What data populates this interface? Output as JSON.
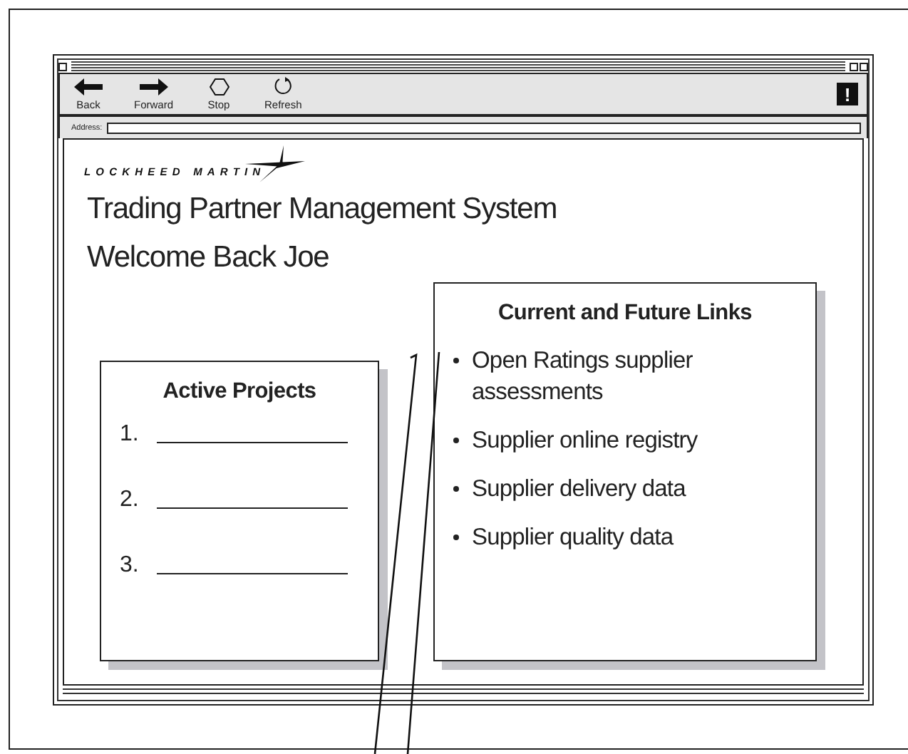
{
  "toolbar": {
    "buttons": [
      {
        "label": "Back",
        "kind": "back"
      },
      {
        "label": "Forward",
        "kind": "forward"
      },
      {
        "label": "Stop",
        "kind": "stop"
      },
      {
        "label": "Refresh",
        "kind": "refresh"
      }
    ],
    "alert": "!"
  },
  "address": {
    "label": "Address:"
  },
  "page": {
    "logo": "LOCKHEED MARTIN",
    "title": "Trading Partner Management System",
    "welcome": "Welcome Back Joe",
    "active_projects": {
      "title": "Active Projects",
      "items": [
        {
          "number": "1."
        },
        {
          "number": "2."
        },
        {
          "number": "3."
        }
      ]
    },
    "links": {
      "title": "Current and Future Links",
      "items": [
        "Open Ratings supplier assessments",
        "Supplier online registry",
        "Supplier delivery data",
        "Supplier quality data"
      ]
    }
  }
}
